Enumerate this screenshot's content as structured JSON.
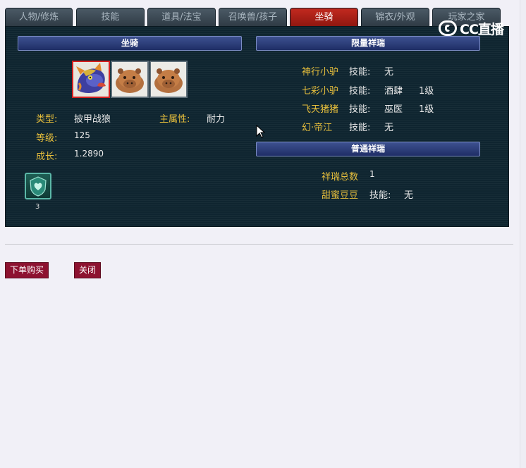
{
  "tabs": [
    {
      "label": "人物/修炼",
      "active": false
    },
    {
      "label": "技能",
      "active": false
    },
    {
      "label": "道具/法宝",
      "active": false
    },
    {
      "label": "召唤兽/孩子",
      "active": false
    },
    {
      "label": "坐骑",
      "active": true
    },
    {
      "label": "锦衣/外观",
      "active": false
    },
    {
      "label": "玩家之家",
      "active": false
    }
  ],
  "logo": {
    "text": "CC直播"
  },
  "mount": {
    "header": "坐骑",
    "type_label": "类型:",
    "type_value": "披甲战狼",
    "attr_label": "主属性:",
    "attr_value": "耐力",
    "level_label": "等级:",
    "level_value": "125",
    "growth_label": "成长:",
    "growth_value": "1.2890",
    "emblem_count": "3"
  },
  "limited": {
    "header": "限量祥瑞",
    "items": [
      {
        "name": "神行小驴",
        "skill_label": "技能:",
        "skill": "无",
        "level": ""
      },
      {
        "name": "七彩小驴",
        "skill_label": "技能:",
        "skill": "酒肆",
        "level": "1级"
      },
      {
        "name": "飞天猪猪",
        "skill_label": "技能:",
        "skill": "巫医",
        "level": "1级"
      },
      {
        "name": "幻·帝江",
        "skill_label": "技能:",
        "skill": "无",
        "level": ""
      }
    ]
  },
  "normal": {
    "header": "普通祥瑞",
    "total_label": "祥瑞总数",
    "total_value": "1",
    "items": [
      {
        "name": "甜蜜豆豆",
        "skill_label": "技能:",
        "skill": "无"
      }
    ]
  },
  "buttons": {
    "buy": "下单购买",
    "close": "关闭"
  },
  "colors": {
    "accent_tab": "#b11f16",
    "panel_bg": "#0f2530",
    "label_gold": "#e6be3c",
    "button_bg": "#8d1230"
  }
}
